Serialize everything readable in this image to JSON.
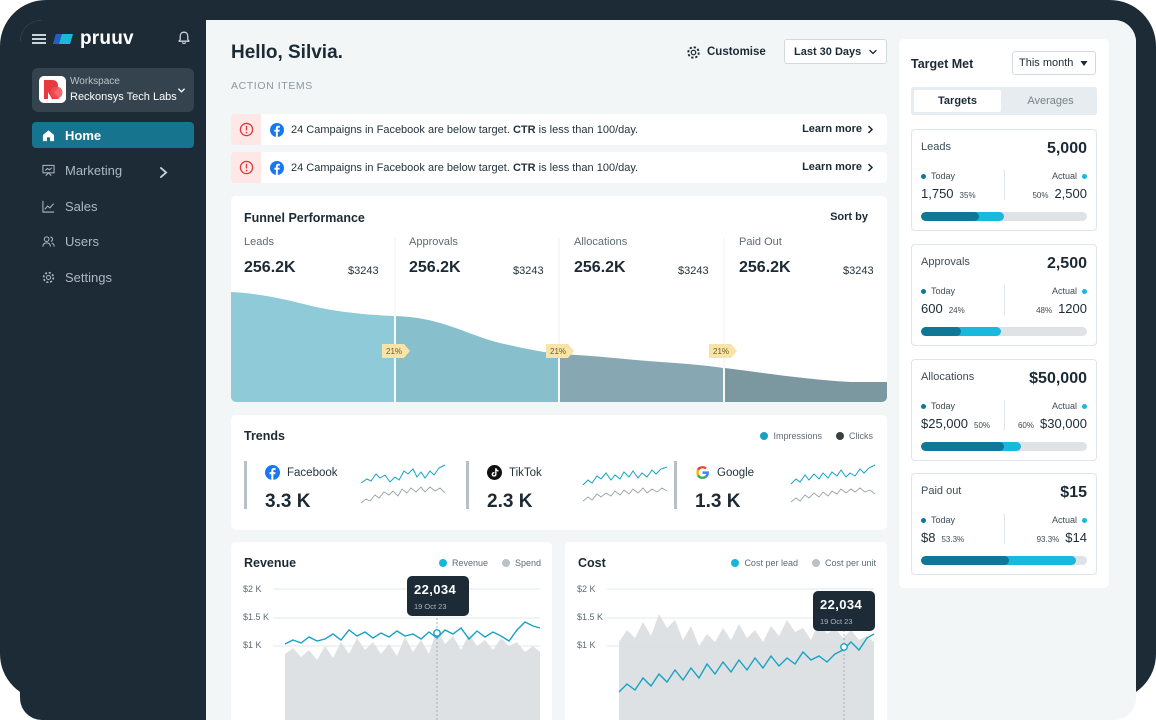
{
  "app": {
    "brand": "pruuv"
  },
  "workspace": {
    "label": "Workspace",
    "name": "Reckonsys Tech Labs"
  },
  "nav": [
    {
      "label": "Home",
      "icon": "home-icon",
      "active": true
    },
    {
      "label": "Marketing",
      "icon": "presentation-icon",
      "active": false
    },
    {
      "label": "Sales",
      "icon": "trend-chart-icon",
      "active": false
    },
    {
      "label": "Users",
      "icon": "users-icon",
      "active": false
    },
    {
      "label": "Settings",
      "icon": "gear-icon",
      "active": false
    }
  ],
  "header": {
    "greeting": "Hello, Silvia.",
    "section": "ACTION ITEMS",
    "customise": "Customise",
    "range": "Last 30 Days"
  },
  "alerts": [
    {
      "pre": "24 Campaigns in Facebook are below target. ",
      "metric": "CTR",
      "post": " is less than 100/day.",
      "link": "Learn more"
    },
    {
      "pre": "24 Campaigns in Facebook are below target. ",
      "metric": "CTR",
      "post": " is less than 100/day.",
      "link": "Learn more"
    }
  ],
  "funnel": {
    "title": "Funnel Performance",
    "sort": "Sort by",
    "stages": [
      {
        "label": "Leads",
        "value": "256.2K",
        "amount": "$3243"
      },
      {
        "label": "Approvals",
        "value": "256.2K",
        "amount": "$3243"
      },
      {
        "label": "Allocations",
        "value": "256.2K",
        "amount": "$3243"
      },
      {
        "label": "Paid Out",
        "value": "256.2K",
        "amount": "$3243"
      }
    ],
    "conversions": [
      "21%",
      "21%",
      "21%"
    ],
    "colors": [
      "#8fcad9",
      "#88bfcc",
      "#87a8b2",
      "#7b98a1"
    ]
  },
  "trends": {
    "title": "Trends",
    "legend": {
      "impressions": "Impressions",
      "clicks": "Clicks"
    },
    "colors": {
      "impressions": "#17a2c4",
      "clicks": "#3a3f42"
    },
    "channels": [
      {
        "name": "Facebook",
        "value": "3.3 K",
        "icon": "facebook-icon"
      },
      {
        "name": "TikTok",
        "value": "2.3 K",
        "icon": "tiktok-icon"
      },
      {
        "name": "Google",
        "value": "1.3 K",
        "icon": "google-icon"
      }
    ]
  },
  "revenue": {
    "title": "Revenue",
    "legend": [
      "Revenue",
      "Spend"
    ],
    "yticks": [
      "$2 K",
      "$1.5 K",
      "$1 K"
    ],
    "tooltip": {
      "value": "22,034",
      "date": "19 Oct 23"
    }
  },
  "cost": {
    "title": "Cost",
    "legend": [
      "Cost per lead",
      "Cost per unit"
    ],
    "yticks": [
      "$2 K",
      "$1.5 K",
      "$1 K"
    ],
    "tooltip": {
      "value": "22,034",
      "date": "19 Oct 23"
    }
  },
  "targets": {
    "title": "Target Met",
    "period": "This month",
    "tabs": [
      "Targets",
      "Averages"
    ],
    "today_label": "Today",
    "actual_label": "Actual",
    "items": [
      {
        "name": "Leads",
        "total": "5,000",
        "today": "1,750",
        "today_pct": "35%",
        "actual": "2,500",
        "actual_pct": "50%",
        "today_frac": 0.35,
        "actual_frac": 0.5
      },
      {
        "name": "Approvals",
        "total": "2,500",
        "today": "600",
        "today_pct": "24%",
        "actual": "1200",
        "actual_pct": "48%",
        "today_frac": 0.24,
        "actual_frac": 0.48
      },
      {
        "name": "Allocations",
        "total": "$50,000",
        "today": "$25,000",
        "today_pct": "50%",
        "actual": "$30,000",
        "actual_pct": "60%",
        "today_frac": 0.5,
        "actual_frac": 0.6
      },
      {
        "name": "Paid out",
        "total": "$15",
        "today": "$8",
        "today_pct": "53.3%",
        "actual": "$14",
        "actual_pct": "93.3%",
        "today_frac": 0.533,
        "actual_frac": 0.933
      }
    ]
  }
}
